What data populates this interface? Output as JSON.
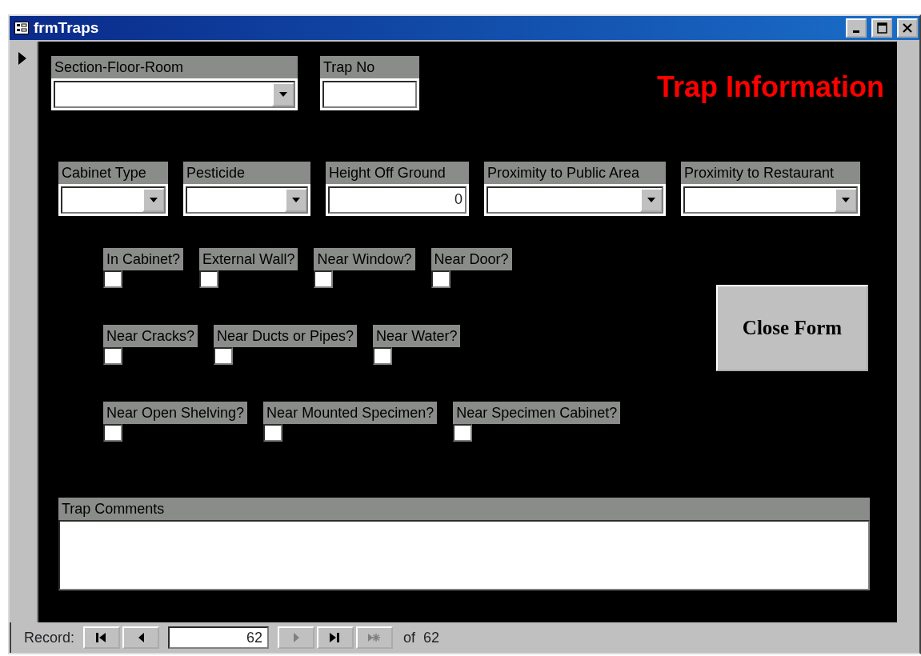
{
  "window": {
    "title": "frmTraps"
  },
  "form": {
    "title": "Trap Information",
    "top_fields": [
      {
        "label": "Section-Floor-Room",
        "kind": "combo"
      },
      {
        "label": "Trap No",
        "kind": "text"
      }
    ],
    "fields": [
      {
        "label": "Cabinet Type",
        "kind": "combo"
      },
      {
        "label": "Pesticide",
        "kind": "combo"
      },
      {
        "label": "Height Off Ground",
        "kind": "text",
        "value": "0"
      },
      {
        "label": "Proximity to Public Area",
        "kind": "combo"
      },
      {
        "label": "Proximity to Restaurant",
        "kind": "combo"
      }
    ],
    "checkbox_rows": [
      {
        "items": [
          {
            "label": "In Cabinet?",
            "checked": false
          },
          {
            "label": "External Wall?",
            "checked": false
          },
          {
            "label": "Near Window?",
            "checked": false
          },
          {
            "label": "Near Door?",
            "checked": false
          }
        ]
      },
      {
        "items": [
          {
            "label": "Near Cracks?",
            "checked": false
          },
          {
            "label": "Near Ducts or Pipes?",
            "checked": false
          },
          {
            "label": "Near Water?",
            "checked": false
          }
        ]
      },
      {
        "items": [
          {
            "label": "Near Open Shelving?",
            "checked": false
          },
          {
            "label": "Near Mounted Specimen?",
            "checked": false
          },
          {
            "label": "Near Specimen Cabinet?",
            "checked": false
          }
        ]
      }
    ],
    "close_button": "Close Form",
    "comments": {
      "label": "Trap Comments"
    }
  },
  "navigation": {
    "label": "Record:",
    "current": "62",
    "total": "of  62",
    "buttons": [
      {
        "kind": "first",
        "disabled": false
      },
      {
        "kind": "prev",
        "disabled": false
      },
      {
        "kind": "next",
        "disabled": true
      },
      {
        "kind": "last",
        "disabled": false
      },
      {
        "kind": "new",
        "disabled": true
      }
    ]
  }
}
